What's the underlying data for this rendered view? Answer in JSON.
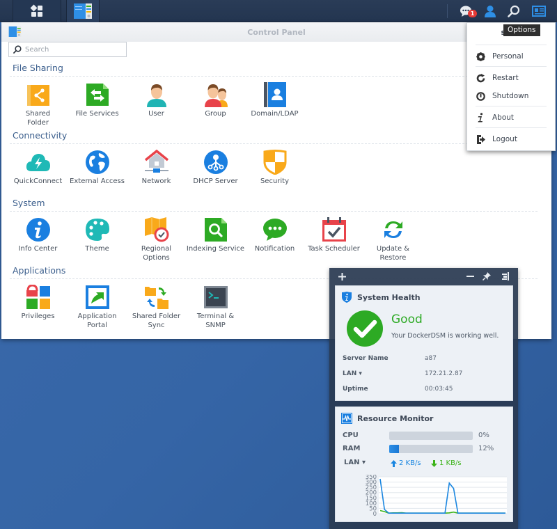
{
  "taskbar": {
    "main_menu_icon": "grid-icon",
    "open_app_icon": "control-panel-icon",
    "notification_count": "1",
    "right_icons": [
      "chat-bubble-icon",
      "user-icon",
      "search-icon",
      "options-card-icon"
    ]
  },
  "control_panel": {
    "title": "Control Panel",
    "search_placeholder": "Search",
    "sections": [
      {
        "title": "File Sharing",
        "items": [
          {
            "label": "Shared\nFolder",
            "icon": "shared-folder-icon"
          },
          {
            "label": "File Services",
            "icon": "file-services-icon"
          },
          {
            "label": "User",
            "icon": "user-icon"
          },
          {
            "label": "Group",
            "icon": "group-icon"
          },
          {
            "label": "Domain/LDAP",
            "icon": "domain-ldap-icon"
          }
        ]
      },
      {
        "title": "Connectivity",
        "items": [
          {
            "label": "QuickConnect",
            "icon": "quickconnect-icon"
          },
          {
            "label": "External Access",
            "icon": "globe-icon"
          },
          {
            "label": "Network",
            "icon": "network-house-icon"
          },
          {
            "label": "DHCP Server",
            "icon": "dhcp-icon"
          },
          {
            "label": "Security",
            "icon": "shield-icon"
          }
        ]
      },
      {
        "title": "System",
        "items": [
          {
            "label": "Info Center",
            "icon": "info-icon"
          },
          {
            "label": "Theme",
            "icon": "palette-icon"
          },
          {
            "label": "Regional\nOptions",
            "icon": "map-clock-icon"
          },
          {
            "label": "Indexing Service",
            "icon": "index-search-icon"
          },
          {
            "label": "Notification",
            "icon": "chat-icon"
          },
          {
            "label": "Task Scheduler",
            "icon": "calendar-check-icon"
          },
          {
            "label": "Update &\nRestore",
            "icon": "refresh-icon"
          }
        ]
      },
      {
        "title": "Applications",
        "items": [
          {
            "label": "Privileges",
            "icon": "privileges-icon"
          },
          {
            "label": "Application\nPortal",
            "icon": "portal-arrow-icon"
          },
          {
            "label": "Shared Folder\nSync",
            "icon": "folder-sync-icon"
          },
          {
            "label": "Terminal &\nSNMP",
            "icon": "terminal-icon"
          }
        ]
      }
    ]
  },
  "options_menu": {
    "user": "syno",
    "tooltip": "Options",
    "items": [
      {
        "label": "Personal",
        "icon": "gear-icon"
      },
      {
        "label": "Restart",
        "icon": "restart-icon"
      },
      {
        "label": "Shutdown",
        "icon": "power-icon"
      },
      {
        "label": "About",
        "icon": "info-i-icon"
      },
      {
        "label": "Logout",
        "icon": "logout-icon"
      }
    ]
  },
  "widgets": {
    "system_health": {
      "title": "System Health",
      "status": "Good",
      "message": "Your DockerDSM is working well.",
      "rows": [
        {
          "label": "Server Name",
          "value": "a87"
        },
        {
          "label": "LAN ▾",
          "value": "172.21.2.87"
        },
        {
          "label": "Uptime",
          "value": "00:03:45"
        }
      ]
    },
    "resource_monitor": {
      "title": "Resource Monitor",
      "cpu_label": "CPU",
      "cpu_percent": 0,
      "cpu_text": "0%",
      "ram_label": "RAM",
      "ram_percent": 12,
      "ram_text": "12%",
      "lan_label": "LAN ▾",
      "upload": "2 KB/s",
      "download": "1 KB/s",
      "colors": {
        "upload": "#1a86e0",
        "download": "#3cb31a"
      }
    }
  },
  "chart_data": {
    "type": "line",
    "title": "",
    "xlabel": "",
    "ylabel": "",
    "ylim": [
      0,
      350
    ],
    "yticks": [
      "350",
      "300",
      "250",
      "200",
      "150",
      "100",
      "50",
      "0"
    ],
    "grid": true,
    "series": [
      {
        "name": "Upload",
        "color": "#1a86e0",
        "values": [
          330,
          40,
          5,
          5,
          5,
          5,
          5,
          5,
          5,
          5,
          5,
          5,
          5,
          5,
          5,
          5,
          290,
          240,
          5,
          5,
          5,
          5,
          5,
          5,
          5,
          5,
          5,
          5,
          5,
          5
        ]
      },
      {
        "name": "Download",
        "color": "#3cb31a",
        "values": [
          30,
          20,
          5,
          8,
          8,
          10,
          5,
          5,
          5,
          5,
          5,
          5,
          5,
          5,
          5,
          5,
          8,
          15,
          5,
          5,
          5,
          5,
          5,
          5,
          5,
          5,
          5,
          5,
          5,
          5
        ]
      }
    ]
  }
}
